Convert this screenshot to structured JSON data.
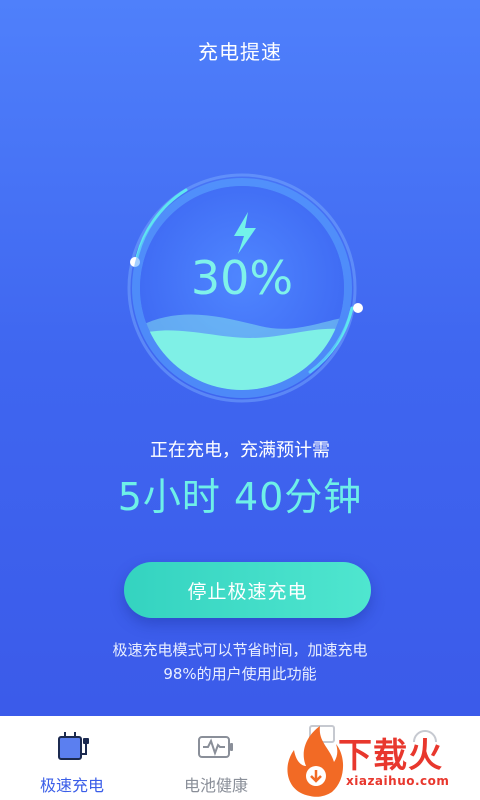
{
  "header": {
    "title": "充电提速"
  },
  "gauge": {
    "percent_text": "30%",
    "level": 0.3,
    "icon": "lightning-icon"
  },
  "status": {
    "label": "正在充电，充满预计需",
    "remaining": "5小时 40分钟"
  },
  "action": {
    "stop_label": "停止极速充电"
  },
  "hint": {
    "line1": "极速充电模式可以节省时间，加速充电",
    "line2": "98%的用户使用此功能"
  },
  "tabs": [
    {
      "label": "极速充电",
      "icon": "fast-charge-icon",
      "active": true
    },
    {
      "label": "电池健康",
      "icon": "battery-health-icon",
      "active": false
    }
  ],
  "watermark": {
    "title": "下载火",
    "subtitle": "xiazaihuo.com"
  },
  "colors": {
    "accent": "#6ef0e8",
    "button": "#3fdcc6",
    "active_tab": "#3b5ee8",
    "inactive_tab": "#8a8f99",
    "watermark": "#e8372d"
  }
}
